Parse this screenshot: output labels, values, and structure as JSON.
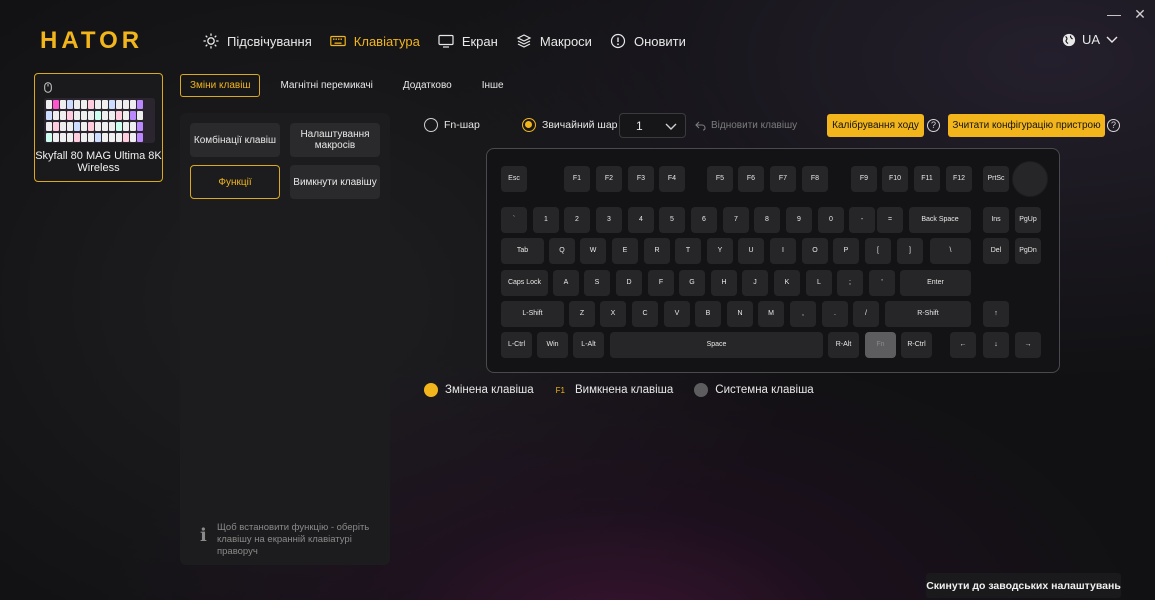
{
  "brand": {
    "logo_text": "HATOR",
    "accent": "#f2b51c"
  },
  "window": {
    "minimize": "—",
    "close": "✕"
  },
  "nav": {
    "items": [
      {
        "label": "Підсвічування",
        "icon": "sun-icon"
      },
      {
        "label": "Клавіатура",
        "icon": "keyboard-icon",
        "active": true
      },
      {
        "label": "Екран",
        "icon": "monitor-icon"
      },
      {
        "label": "Макроси",
        "icon": "layers-icon"
      },
      {
        "label": "Оновити",
        "icon": "update-icon"
      }
    ],
    "language": "UA"
  },
  "device": {
    "name": "Skyfall 80 MAG Ultima 8K Wireless"
  },
  "subtabs": [
    {
      "label": "Зміни клавіш",
      "active": true
    },
    {
      "label": "Магнітні перемикачі"
    },
    {
      "label": "Додатково"
    },
    {
      "label": "Інше"
    }
  ],
  "left_panel": {
    "buttons": [
      {
        "label": "Комбінації клавіш"
      },
      {
        "label": "Налаштування макросів"
      },
      {
        "label": "Функції",
        "active": true
      },
      {
        "label": "Вимкнути клавішу"
      }
    ],
    "hint": "Щоб встановити функцію - оберіть клавішу на екранній клавіатурі праворуч"
  },
  "layers": {
    "fn_layer": "Fn-шар",
    "normal_layer": "Звичайний шар",
    "selected_value": "1",
    "restore_label": "Відновити клавішу"
  },
  "actions": {
    "calibrate": "Калібрування ходу",
    "read_config": "Зчитати конфігурацію пристрою",
    "help": "?",
    "reset": "Скинути до заводських налаштувань"
  },
  "keyboard": {
    "rows": [
      [
        "Esc",
        "F1",
        "F2",
        "F3",
        "F4",
        "F5",
        "F6",
        "F7",
        "F8",
        "F9",
        "F10",
        "F11",
        "F12",
        "PrtSc"
      ],
      [
        "`",
        "1",
        "2",
        "3",
        "4",
        "5",
        "6",
        "7",
        "8",
        "9",
        "0",
        "-",
        "=",
        "Back Space",
        "Ins",
        "PgUp"
      ],
      [
        "Tab",
        "Q",
        "W",
        "E",
        "R",
        "T",
        "Y",
        "U",
        "I",
        "O",
        "P",
        "[",
        "]",
        "\\",
        "Del",
        "PgDn"
      ],
      [
        "Caps Lock",
        "A",
        "S",
        "D",
        "F",
        "G",
        "H",
        "J",
        "K",
        "L",
        ";",
        "'",
        "Enter"
      ],
      [
        "L-Shift",
        "Z",
        "X",
        "C",
        "V",
        "B",
        "N",
        "M",
        ",",
        ".",
        "/",
        "R-Shift",
        "↑"
      ],
      [
        "L-Ctrl",
        "Win",
        "L-Alt",
        "Space",
        "R-Alt",
        "Fn",
        "R-Ctrl",
        "←",
        "↓",
        "→"
      ]
    ]
  },
  "legend": {
    "changed": "Змінена клавіша",
    "disabled_sample": "F1",
    "disabled": "Вимкнена клавіша",
    "system": "Системна клавіша",
    "colors": {
      "changed": "#f2b51c",
      "system": "#5d5d60"
    }
  }
}
